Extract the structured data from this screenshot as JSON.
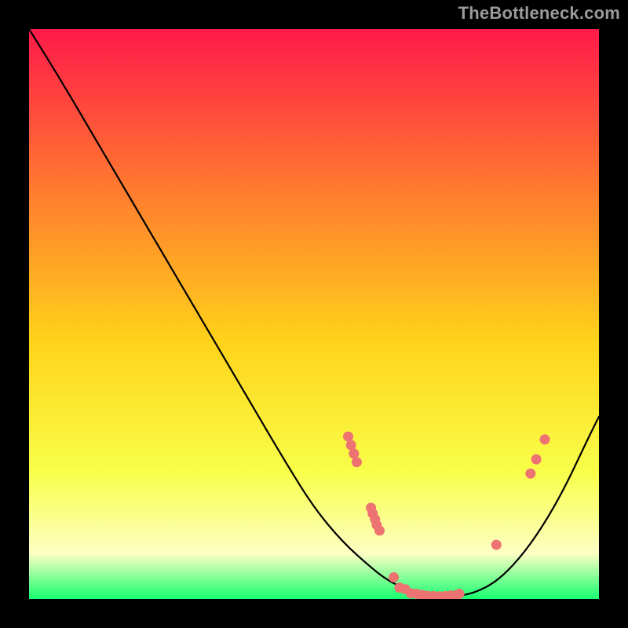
{
  "attribution": "TheBottleneck.com",
  "colors": {
    "frame_bg": "#000000",
    "gradient_top": "#ff1a4a",
    "gradient_mid_upper": "#ff7a2f",
    "gradient_mid": "#ffd31a",
    "gradient_lower": "#f8ff4a",
    "gradient_pale": "#fdffc4",
    "gradient_bottom": "#17ff70",
    "curve": "#000000",
    "dot": "#ed7373"
  },
  "chart_data": {
    "type": "line",
    "title": "",
    "xlabel": "",
    "ylabel": "",
    "xlim": [
      0,
      100
    ],
    "ylim": [
      0,
      100
    ],
    "x": [
      0,
      5,
      10,
      15,
      20,
      25,
      30,
      35,
      40,
      45,
      50,
      55,
      60,
      63,
      66,
      69,
      72,
      75,
      78,
      82,
      86,
      90,
      94,
      98,
      100
    ],
    "values": [
      100,
      92,
      83.5,
      75,
      66.5,
      58,
      49.5,
      41,
      32.5,
      24,
      16,
      10,
      5.5,
      3.2,
      1.8,
      0.9,
      0.45,
      0.5,
      1.0,
      3.0,
      7.0,
      12.5,
      19.5,
      28,
      32
    ],
    "markers": [
      {
        "x": 56,
        "y": 28.5
      },
      {
        "x": 56.5,
        "y": 27
      },
      {
        "x": 57,
        "y": 25.5
      },
      {
        "x": 57.5,
        "y": 24
      },
      {
        "x": 60,
        "y": 16
      },
      {
        "x": 60.3,
        "y": 15
      },
      {
        "x": 60.7,
        "y": 14
      },
      {
        "x": 61,
        "y": 13
      },
      {
        "x": 61.5,
        "y": 12
      },
      {
        "x": 64,
        "y": 3.8
      },
      {
        "x": 65,
        "y": 2.0
      },
      {
        "x": 66,
        "y": 1.7
      },
      {
        "x": 67,
        "y": 1.0
      },
      {
        "x": 68,
        "y": 0.9
      },
      {
        "x": 69,
        "y": 0.7
      },
      {
        "x": 70,
        "y": 0.55
      },
      {
        "x": 71,
        "y": 0.5
      },
      {
        "x": 72,
        "y": 0.45
      },
      {
        "x": 73,
        "y": 0.5
      },
      {
        "x": 74,
        "y": 0.6
      },
      {
        "x": 75,
        "y": 0.7
      },
      {
        "x": 75.5,
        "y": 0.9
      },
      {
        "x": 82,
        "y": 9.5
      },
      {
        "x": 88,
        "y": 22
      },
      {
        "x": 89,
        "y": 24.5
      },
      {
        "x": 90.5,
        "y": 28
      }
    ]
  }
}
